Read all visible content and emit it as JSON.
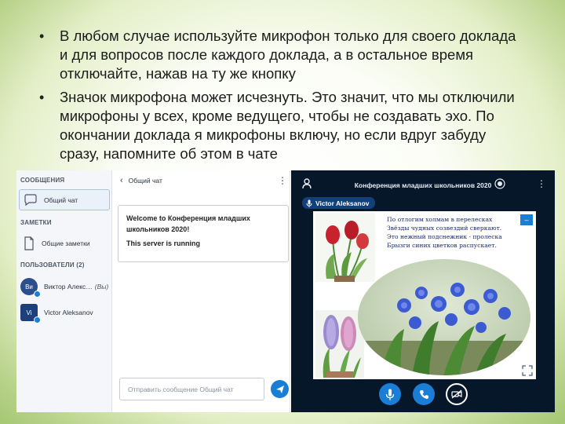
{
  "bullets": [
    "В любом случае используйте микрофон только для своего доклада и для вопросов после каждого доклада, а в остальное время отключайте, нажав на ту же кнопку",
    "Значок микрофона может исчезнуть. Это значит, что мы отключили микрофоны у всех, кроме ведущего, чтобы не создавать эхо. По окончании доклада я микрофоны включу, но если вдруг забуду сразу, напомните об этом в чате"
  ],
  "sidebar": {
    "messages_header": "СООБЩЕНИЯ",
    "public_chat": "Общий чат",
    "notes_header": "ЗАМЕТКИ",
    "shared_notes": "Общие заметки",
    "users_header": "ПОЛЬЗОВАТЕЛИ (2)",
    "users": [
      {
        "initials": "Ви",
        "name": "Виктор Алекс…",
        "tag": "(Вы)"
      },
      {
        "initials": "Vi",
        "name": "Victor Aleksanov",
        "tag": ""
      }
    ]
  },
  "chat": {
    "title": "Общий чат",
    "welcome_prefix": "Welcome to ",
    "welcome_bold": "Конференция младших школьников 2020",
    "welcome_suffix": "!",
    "server_status": "This server is running",
    "input_placeholder": "Отправить сообщение Общий чат"
  },
  "presentation": {
    "title": "Конференция младших школьников 2020",
    "presenter": "Victor Aleksanov",
    "poem": [
      "По отлогим холмам в перелесках",
      "Звёзды чудных созвездий сверкают.",
      "Это нежный подснежник - пролеска",
      "Брызги синих цветков распускает."
    ],
    "minimize_label": "–"
  },
  "icons": {
    "user": "user-icon",
    "record": "record-icon",
    "mic": "microphone-icon",
    "phone": "phone-icon",
    "camera": "camera-off-icon",
    "send": "send-icon"
  },
  "colors": {
    "accent": "#1a7ed6",
    "presentation_bg": "#06172a",
    "presenter_badge": "#12407a"
  }
}
